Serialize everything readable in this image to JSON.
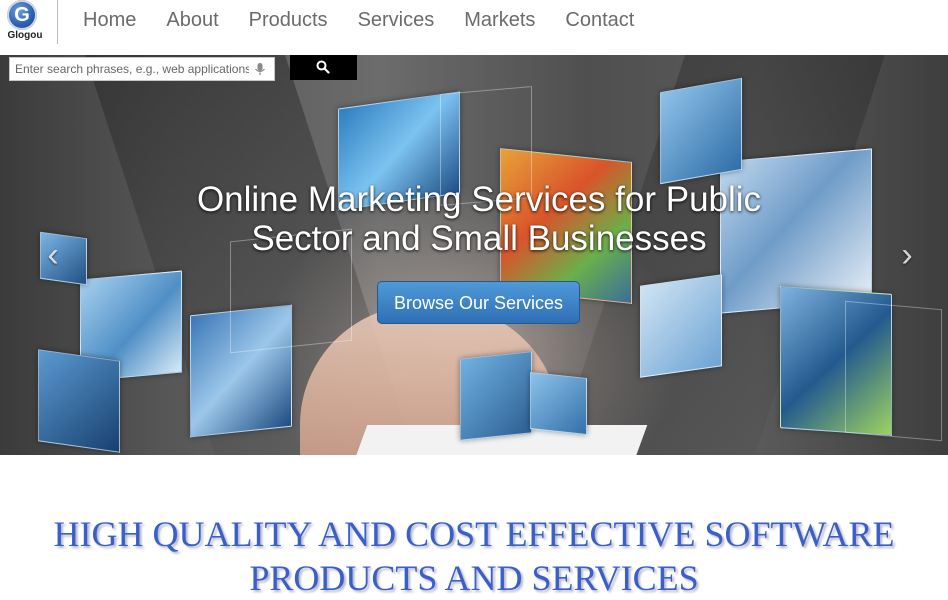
{
  "logo": {
    "letter": "G",
    "name": "Glogou"
  },
  "nav": {
    "items": [
      {
        "label": "Home"
      },
      {
        "label": "About"
      },
      {
        "label": "Products"
      },
      {
        "label": "Services"
      },
      {
        "label": "Markets"
      },
      {
        "label": "Contact"
      }
    ]
  },
  "search": {
    "placeholder": "Enter search phrases, e.g., web applications",
    "value": "",
    "button_icon": "search-icon",
    "mic_icon": "microphone-icon"
  },
  "hero": {
    "title_line1": "Online Marketing Services for Public",
    "title_line2": "Sector and Small Businesses",
    "cta_label": "Browse Our Services",
    "prev_icon": "chevron-left-icon",
    "next_icon": "chevron-right-icon",
    "prev_glyph": "‹",
    "next_glyph": "›"
  },
  "section": {
    "heading": "HIGH QUALITY AND COST EFFECTIVE SOFTWARE PRODUCTS AND SERVICES"
  },
  "colors": {
    "nav_text": "#6b6b6b",
    "cta_blue": "#3b82c8",
    "heading_blue": "#3a5fc8",
    "logo_blue": "#2a5fb0"
  }
}
